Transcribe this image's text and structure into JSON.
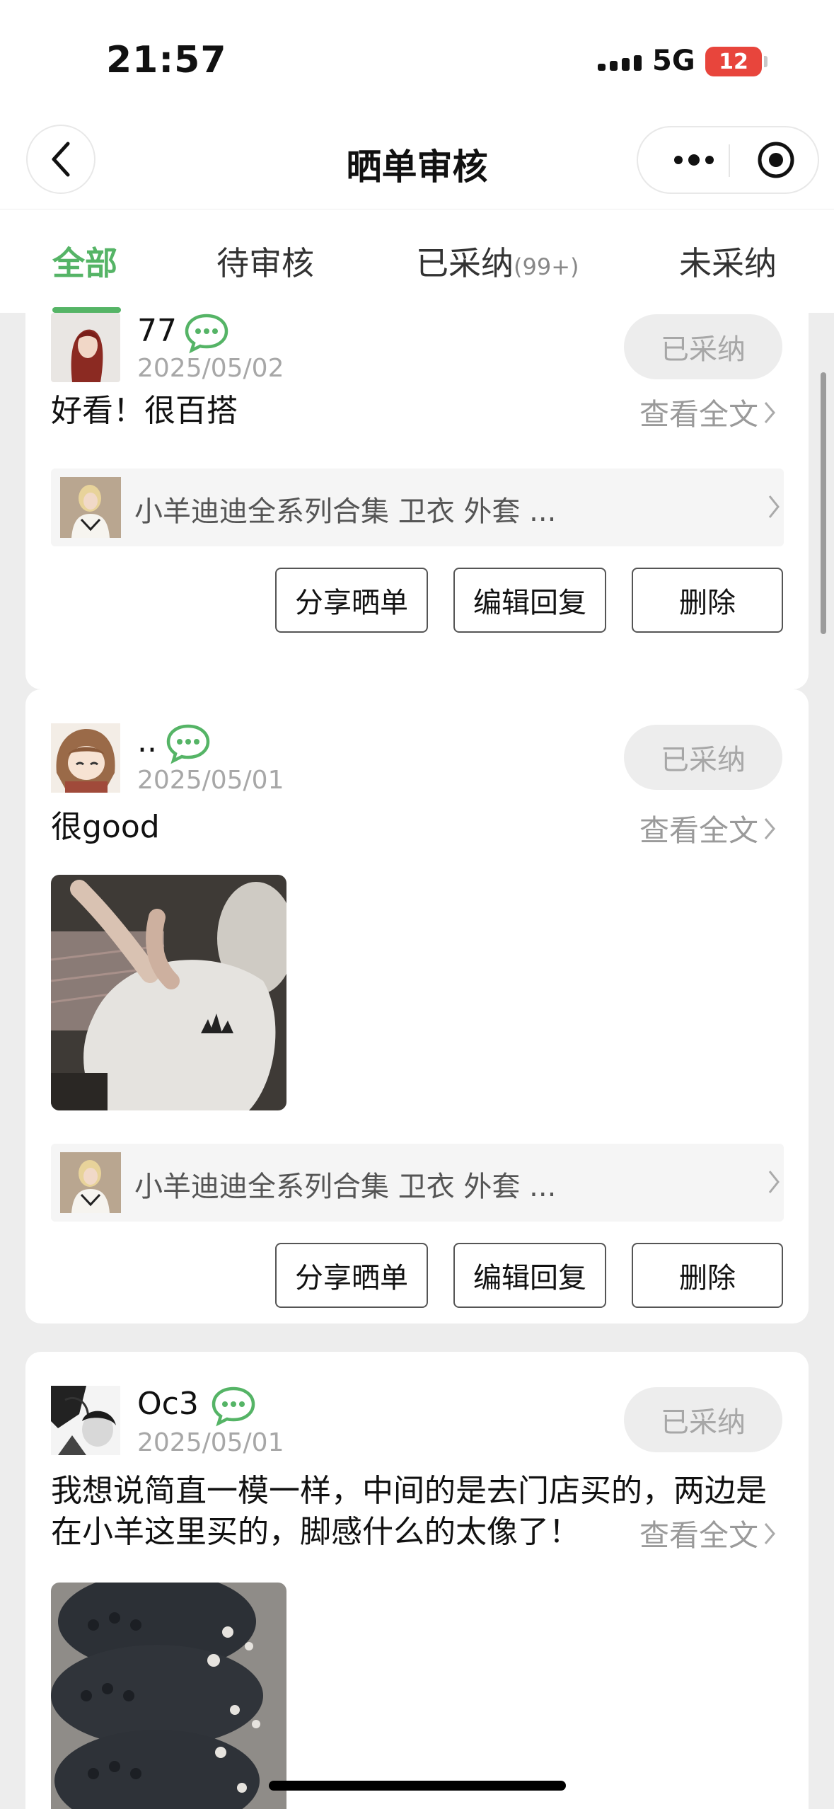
{
  "status_bar": {
    "time": "21:57",
    "network": "5G",
    "battery": "12"
  },
  "nav": {
    "title": "晒单审核",
    "back_icon": "chevron-left-icon",
    "more_icon": "more-dots-icon",
    "close_icon": "target-close-icon"
  },
  "tabs": [
    {
      "label": "全部",
      "active": true
    },
    {
      "label": "待审核",
      "active": false
    },
    {
      "label": "已采纳",
      "count": "(99+)",
      "active": false
    },
    {
      "label": "未采纳",
      "active": false
    }
  ],
  "colors": {
    "accent": "#55b466",
    "background": "#ededed",
    "muted": "#a7a7a7"
  },
  "reviews": [
    {
      "username": "77",
      "date": "2025/05/02",
      "status": "已采纳",
      "content": "好看！很百搭",
      "view_full": "查看全文",
      "product_name": "小羊迪迪全系列合集 卫衣 外套 ...",
      "buttons": {
        "share": "分享晒单",
        "edit_reply": "编辑回复",
        "delete": "删除"
      }
    },
    {
      "username": "..",
      "date": "2025/05/01",
      "status": "已采纳",
      "content": "很good",
      "view_full": "查看全文",
      "product_name": "小羊迪迪全系列合集 卫衣 外套 ...",
      "buttons": {
        "share": "分享晒单",
        "edit_reply": "编辑回复",
        "delete": "删除"
      }
    },
    {
      "username": "Oc3",
      "date": "2025/05/01",
      "status": "已采纳",
      "content_line1": "我想说简直一模一样，中间的是去门店买的，两边是",
      "content_line2": "在小羊这里买的，脚感什么的太像了！",
      "view_full": "查看全文"
    }
  ]
}
